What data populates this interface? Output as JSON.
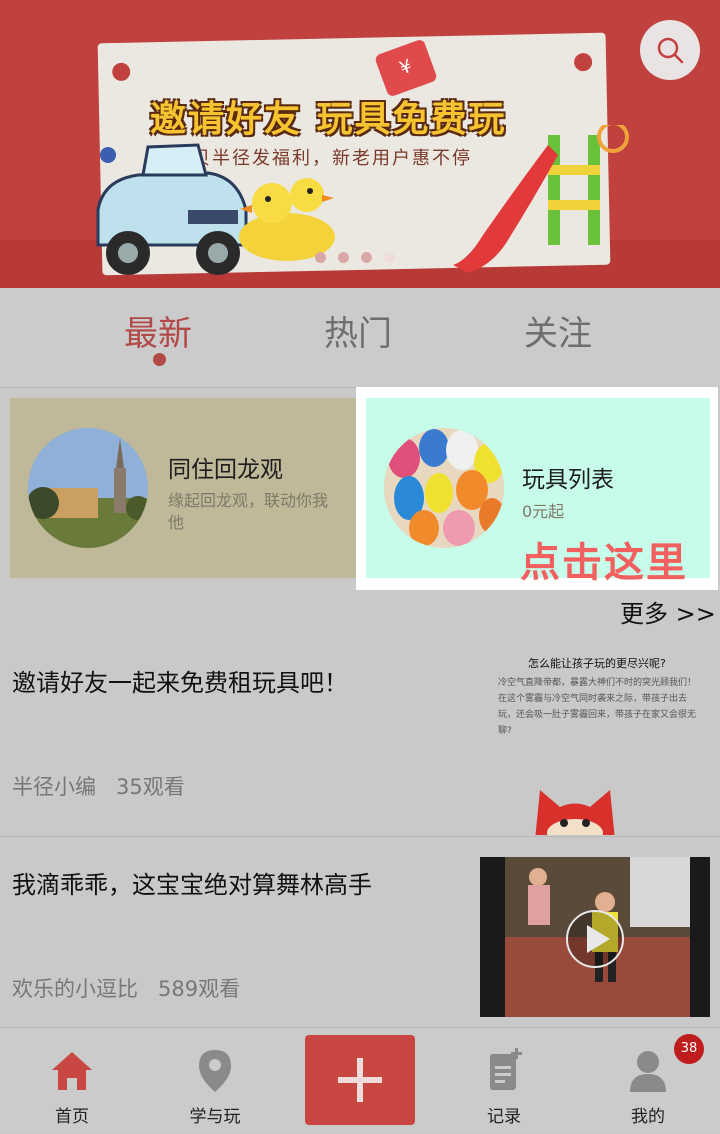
{
  "banner": {
    "title": "邀请好友  玩具免费玩",
    "subtitle": "宝贝半径发福利，新老用户惠不停",
    "tag_symbol": "¥",
    "slide_count": 4,
    "active_slide": 4
  },
  "tabs": [
    {
      "label": "最新",
      "active": true
    },
    {
      "label": "热门",
      "active": false
    },
    {
      "label": "关注",
      "active": false
    }
  ],
  "channels": [
    {
      "title": "同住回龙观",
      "desc": "缘起回龙观，联动你我他"
    },
    {
      "title": "玩具列表",
      "desc": "0元起",
      "overlay": "点击这里"
    }
  ],
  "more_label": "更多 >>",
  "articles": [
    {
      "title": "邀请好友一起来免费租玩具吧！",
      "author": "半径小编",
      "views": "35观看",
      "thumb_title": "怎么能让孩子玩的更尽兴呢?",
      "thumb_text": "冷空气直降帝都，暴露大神们不时的突光顾我们！在这个雾霾与冷空气同时袭来之际，带孩子出去玩，还会吸一肚子雾霾回来，带孩子在家又会很无聊?"
    },
    {
      "title": "我滴乖乖，这宝宝绝对算舞林高手",
      "author": "欢乐的小逗比",
      "views": "589观看"
    }
  ],
  "nav": {
    "home": "首页",
    "learn_play": "学与玩",
    "records": "记录",
    "mine": "我的",
    "badge_count": "38"
  },
  "colors": {
    "accent": "#b24946",
    "banner_bg": "#c0413e",
    "highlight_card": "#c7fbea",
    "overlay_text": "#f25f5f"
  }
}
